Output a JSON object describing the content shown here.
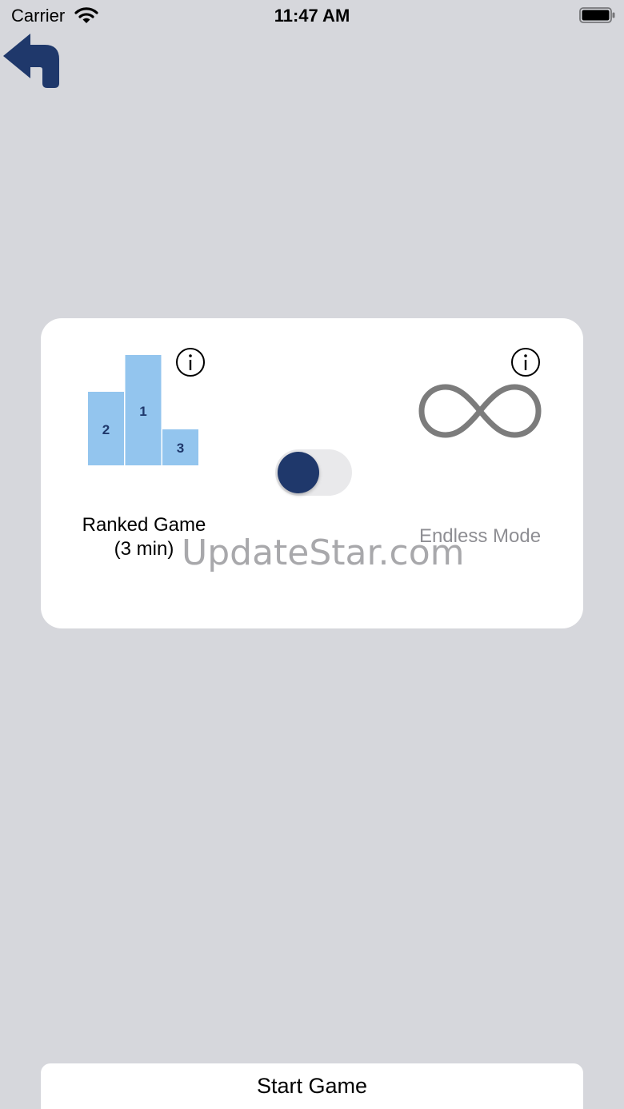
{
  "status_bar": {
    "carrier": "Carrier",
    "time": "11:47 AM"
  },
  "nav": {
    "back_icon": "back-arrow-icon"
  },
  "mode_card": {
    "ranked": {
      "icon": "podium-icon",
      "podium_places": [
        "2",
        "1",
        "3"
      ],
      "label_line1": "Ranked Game",
      "label_line2": "(3 min)"
    },
    "endless": {
      "icon": "infinity-icon",
      "label": "Endless Mode"
    },
    "toggle": {
      "selected": "ranked"
    },
    "watermark": "UpdateStar.com"
  },
  "actions": {
    "start_label": "Start Game"
  },
  "colors": {
    "background": "#d6d7dc",
    "accent": "#1f386b",
    "podium": "#93c5ee",
    "muted": "#8e8e93"
  }
}
